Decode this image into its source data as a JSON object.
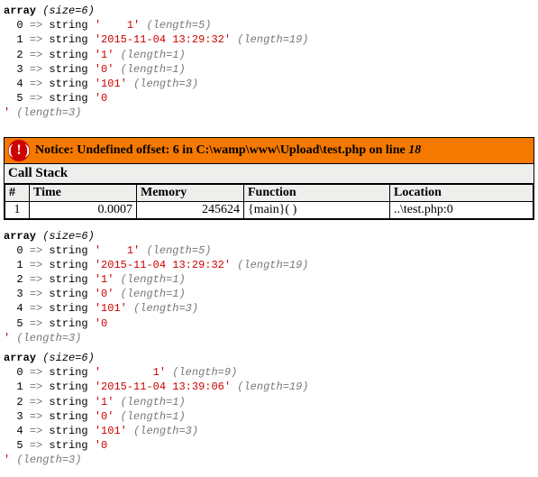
{
  "dump1": {
    "header_a": "array",
    "header_b": "(size=6)",
    "items": [
      {
        "idx": "0",
        "type": "string",
        "val": "'    1'",
        "len": "(length=5)"
      },
      {
        "idx": "1",
        "type": "string",
        "val": "'2015-11-04 13:29:32'",
        "len": "(length=19)"
      },
      {
        "idx": "2",
        "type": "string",
        "val": "'1'",
        "len": "(length=1)"
      },
      {
        "idx": "3",
        "type": "string",
        "val": "'0'",
        "len": "(length=1)"
      },
      {
        "idx": "4",
        "type": "string",
        "val": "'101'",
        "len": "(length=3)"
      },
      {
        "idx": "5",
        "type": "string",
        "val": "'0",
        "len": ""
      }
    ],
    "tail": "' (length=3)"
  },
  "error": {
    "label": "Notice: ",
    "msg": "Undefined offset: 6 in C:\\wamp\\www\\Upload\\test.php on line ",
    "line": "18",
    "cs_label": "Call Stack",
    "headers": {
      "n": "#",
      "time": "Time",
      "mem": "Memory",
      "func": "Function",
      "loc": "Location"
    },
    "row": {
      "n": "1",
      "time": "0.0007",
      "mem": "245624",
      "func": "{main}( )",
      "loc": "..\\test.php:0"
    }
  },
  "dump2": {
    "header_a": "array",
    "header_b": "(size=6)",
    "items": [
      {
        "idx": "0",
        "type": "string",
        "val": "'    1'",
        "len": "(length=5)"
      },
      {
        "idx": "1",
        "type": "string",
        "val": "'2015-11-04 13:29:32'",
        "len": "(length=19)"
      },
      {
        "idx": "2",
        "type": "string",
        "val": "'1'",
        "len": "(length=1)"
      },
      {
        "idx": "3",
        "type": "string",
        "val": "'0'",
        "len": "(length=1)"
      },
      {
        "idx": "4",
        "type": "string",
        "val": "'101'",
        "len": "(length=3)"
      },
      {
        "idx": "5",
        "type": "string",
        "val": "'0",
        "len": ""
      }
    ],
    "tail": "' (length=3)"
  },
  "dump3": {
    "header_a": "array",
    "header_b": "(size=6)",
    "items": [
      {
        "idx": "0",
        "type": "string",
        "val": "'        1'",
        "len": "(length=9)"
      },
      {
        "idx": "1",
        "type": "string",
        "val": "'2015-11-04 13:39:06'",
        "len": "(length=19)"
      },
      {
        "idx": "2",
        "type": "string",
        "val": "'1'",
        "len": "(length=1)"
      },
      {
        "idx": "3",
        "type": "string",
        "val": "'0'",
        "len": "(length=1)"
      },
      {
        "idx": "4",
        "type": "string",
        "val": "'101'",
        "len": "(length=3)"
      },
      {
        "idx": "5",
        "type": "string",
        "val": "'0",
        "len": ""
      }
    ],
    "tail": "' (length=3)"
  }
}
